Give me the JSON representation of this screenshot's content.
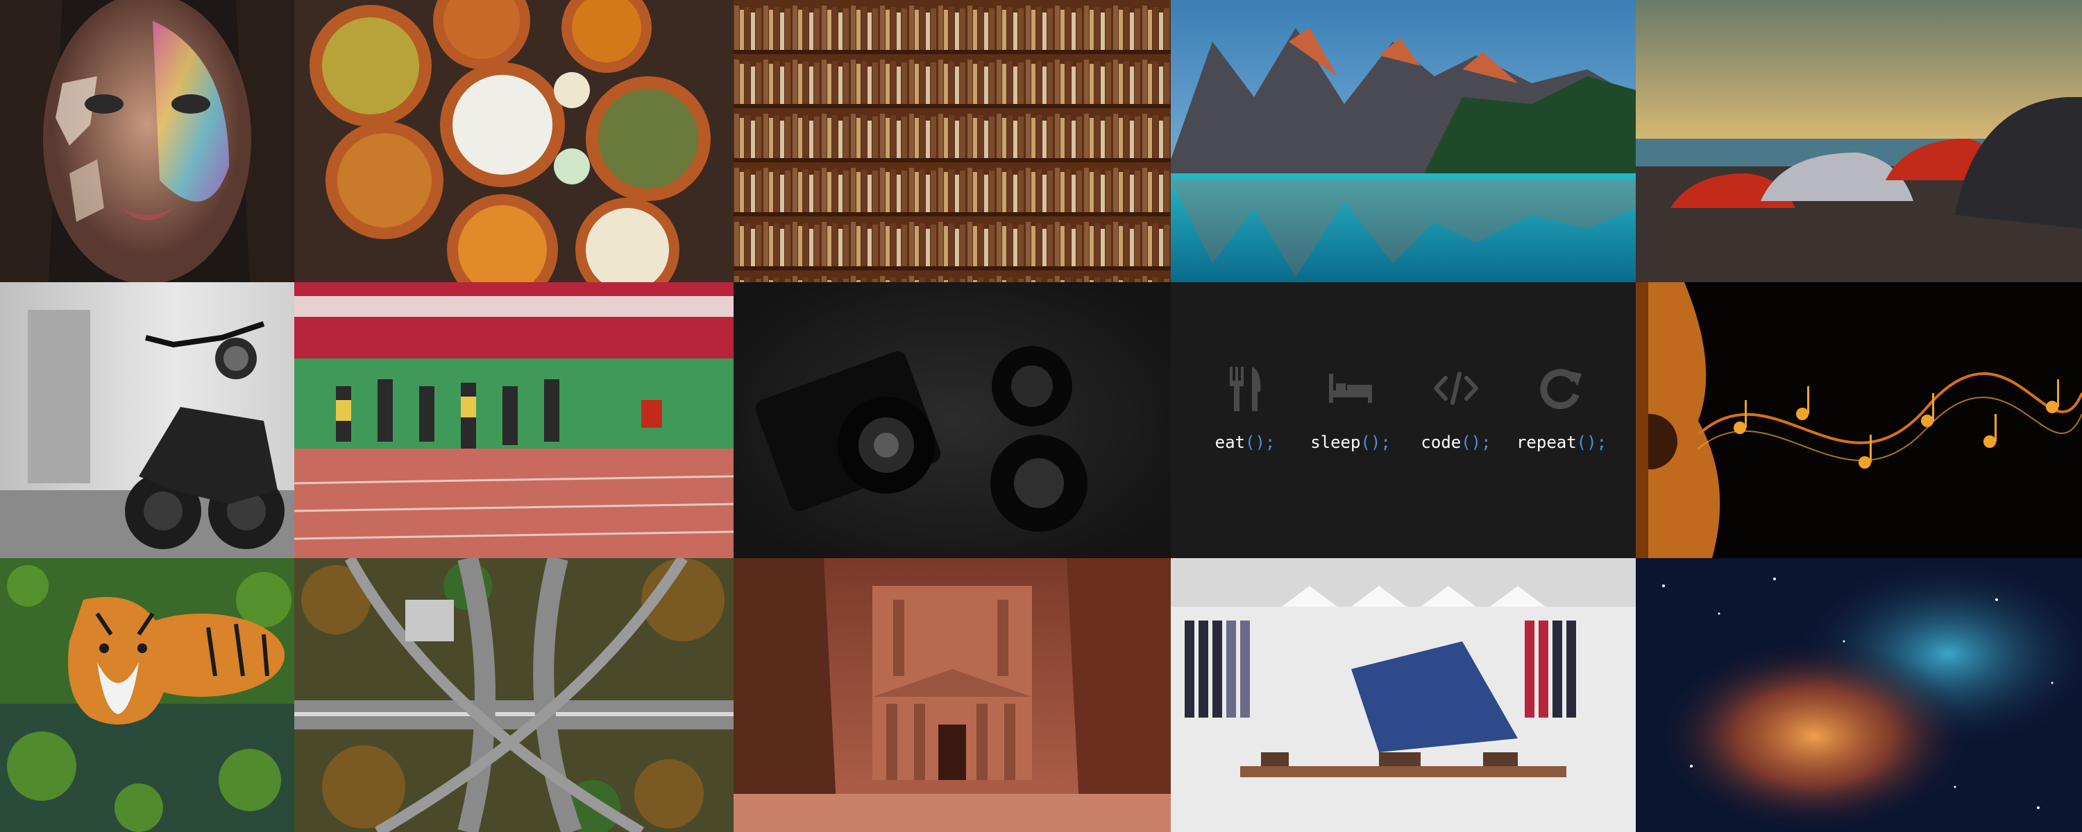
{
  "gallery": {
    "tiles": [
      {
        "name": "painted-face-photo",
        "colors": {
          "bg": "#1d1715",
          "skin": "#b98a76"
        }
      },
      {
        "name": "indian-food-bowls-photo",
        "colors": {
          "bg": "#3a2a22",
          "bowl": "#b85a25"
        }
      },
      {
        "name": "bookshelf-photo",
        "colors": {
          "wood": "#5a2f15",
          "books": "#8a5a3a"
        }
      },
      {
        "name": "mountain-lake-photo",
        "colors": {
          "sky": "#4a8fbf",
          "lake": "#2ab6c8",
          "peaks": "#c8623a"
        }
      },
      {
        "name": "supercars-sunset-photo",
        "colors": {
          "sky": "#d8b873",
          "road": "#3a3330"
        }
      },
      {
        "name": "motorcycle-garage-photo",
        "colors": {
          "wall": "#d9d9d9",
          "bike": "#1c1c1c"
        }
      },
      {
        "name": "sprinters-track-photo",
        "colors": {
          "track": "#c96a5e",
          "field": "#3f9a5a"
        }
      },
      {
        "name": "camera-lenses-photo",
        "colors": {
          "bg": "#1e1e1e",
          "lens": "#0a0a0a"
        }
      },
      {
        "name": "code-motto-tile",
        "colors": {
          "bg": "#1b1b1c",
          "icon": "#4a4a4a"
        }
      },
      {
        "name": "guitar-music-notes-photo",
        "colors": {
          "bg": "#050403",
          "guitar": "#c06a1d",
          "notes": "#f2a32a"
        }
      },
      {
        "name": "tiger-water-photo",
        "colors": {
          "fur": "#d9832a",
          "algae": "#5b9b2a"
        }
      },
      {
        "name": "highway-interchange-aerial-photo",
        "colors": {
          "road": "#8a8a8a",
          "trees": "#7a5a22"
        }
      },
      {
        "name": "petra-treasury-photo",
        "colors": {
          "rock": "#a3533b",
          "sand": "#c9816a"
        }
      },
      {
        "name": "clothing-store-photo",
        "colors": {
          "wall": "#eaeaea",
          "accent": "#2e4a8a"
        }
      },
      {
        "name": "nebula-space-photo",
        "colors": {
          "space": "#0c1530",
          "nebula": "#d06a2a"
        }
      }
    ]
  },
  "motto": [
    {
      "label": "eat",
      "suffix": "();",
      "icon": "fork-knife-icon"
    },
    {
      "label": "sleep",
      "suffix": "();",
      "icon": "bed-icon"
    },
    {
      "label": "code",
      "suffix": "();",
      "icon": "code-brackets-icon"
    },
    {
      "label": "repeat",
      "suffix": "();",
      "icon": "repeat-icon"
    }
  ]
}
